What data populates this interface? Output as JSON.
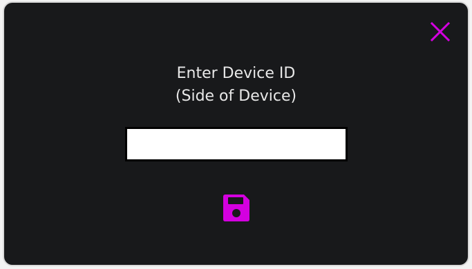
{
  "dialog": {
    "title_line1": "Enter Device ID",
    "title_line2": "(Side of Device)",
    "input": {
      "value": "",
      "placeholder": ""
    },
    "close_icon": "close-icon",
    "save_icon": "save-icon"
  },
  "colors": {
    "background": "#18191b",
    "accent": "#d400e0",
    "text": "#e8e8e8",
    "border": "#d9d9d9"
  }
}
